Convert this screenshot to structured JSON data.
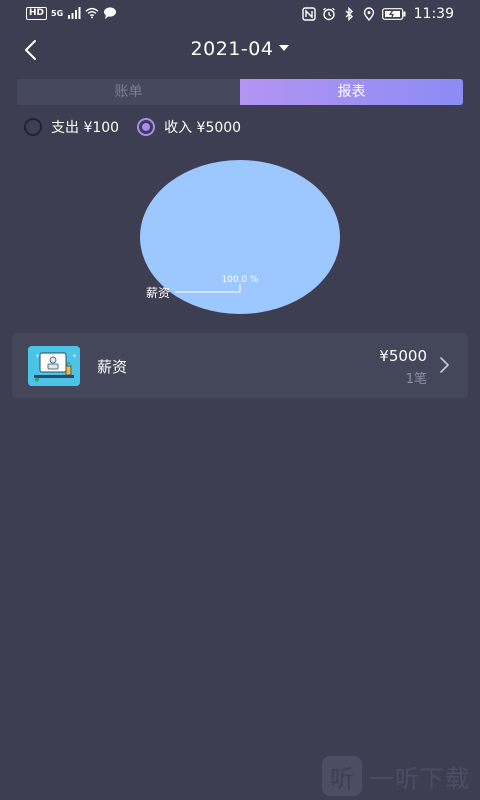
{
  "status_bar": {
    "left_badge": "HD",
    "network": "5G",
    "time": "11:39",
    "icons": [
      "signal-icon",
      "wifi-icon",
      "message-icon",
      "nfc-icon",
      "alarm-icon",
      "bluetooth-icon",
      "location-icon",
      "battery-icon"
    ]
  },
  "header": {
    "month": "2021-04"
  },
  "tabs": [
    {
      "label": "账单",
      "active": false
    },
    {
      "label": "报表",
      "active": true
    }
  ],
  "filters": [
    {
      "label": "支出 ¥100",
      "checked": false
    },
    {
      "label": "收入 ¥5000",
      "checked": true
    }
  ],
  "chart_data": {
    "type": "pie",
    "slices": [
      {
        "label": "薪资",
        "value": 100.0,
        "percent_label": "100.0 %",
        "color": "#9dc8ff"
      }
    ]
  },
  "categories": [
    {
      "name": "薪资",
      "amount": "¥5000",
      "count": "1笔",
      "icon": "salary-icon"
    }
  ],
  "watermark": {
    "logo_char": "听",
    "text": "一听下载"
  },
  "colors": {
    "background": "#3d3e52",
    "card": "#444659",
    "accent": "#a68bf0",
    "tab_gradient_start": "#b394f2",
    "tab_gradient_end": "#8b8cf4",
    "pie": "#9dc8ff"
  }
}
